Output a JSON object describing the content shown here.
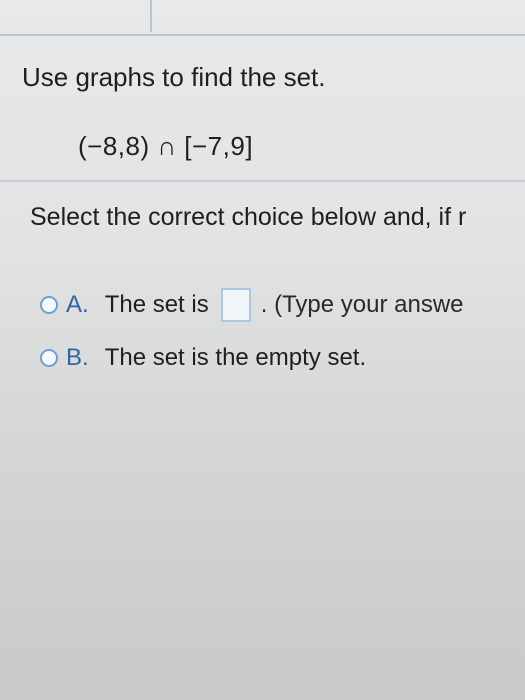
{
  "question": {
    "title": "Use graphs to find the set.",
    "expression": "(−8,8) ∩ [−7,9]"
  },
  "instructions": "Select the correct choice below and, if r",
  "options": [
    {
      "letter": "A.",
      "text": "The set is",
      "after_blank": ". (Type your answe"
    },
    {
      "letter": "B.",
      "text": "The set is the empty set."
    }
  ]
}
